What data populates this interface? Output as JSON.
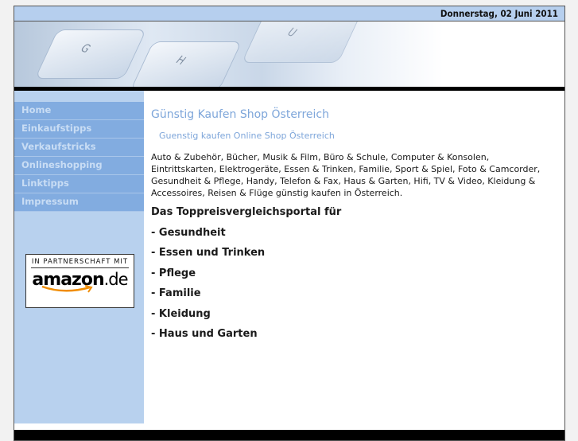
{
  "header": {
    "date": "Donnerstag, 02 Juni 2011",
    "banner_keys": [
      "G",
      "H",
      "U"
    ]
  },
  "nav": [
    "Home",
    "Einkaufstipps",
    "Verkaufstricks",
    "Onlineshopping",
    "Linktipps",
    "Impressum"
  ],
  "partner": {
    "line1": "IN PARTNERSCHAFT MIT",
    "brand": "amazon",
    "tld": ".de"
  },
  "main": {
    "title": "Günstig Kaufen Shop Österreich",
    "subtitle": "Guenstig kaufen Online Shop Österreich",
    "paragraph": "Auto & Zubehör, Bücher, Musik & Film, Büro & Schule, Computer & Konsolen, Eintrittskarten, Elektrogeräte, Essen & Trinken, Familie, Sport & Spiel, Foto & Camcorder, Gesundheit & Pflege, Handy, Telefon & Fax, Haus & Garten, Hifi, TV & Video, Kleidung & Accessoires, Reisen & Flüge günstig kaufen in Österreich.",
    "portal_heading": "Das Toppreisvergleichsportal für",
    "items": [
      "- Gesundheit",
      "- Essen und Trinken",
      "- Pflege",
      "- Familie",
      "- Kleidung",
      "- Haus und Garten"
    ]
  }
}
